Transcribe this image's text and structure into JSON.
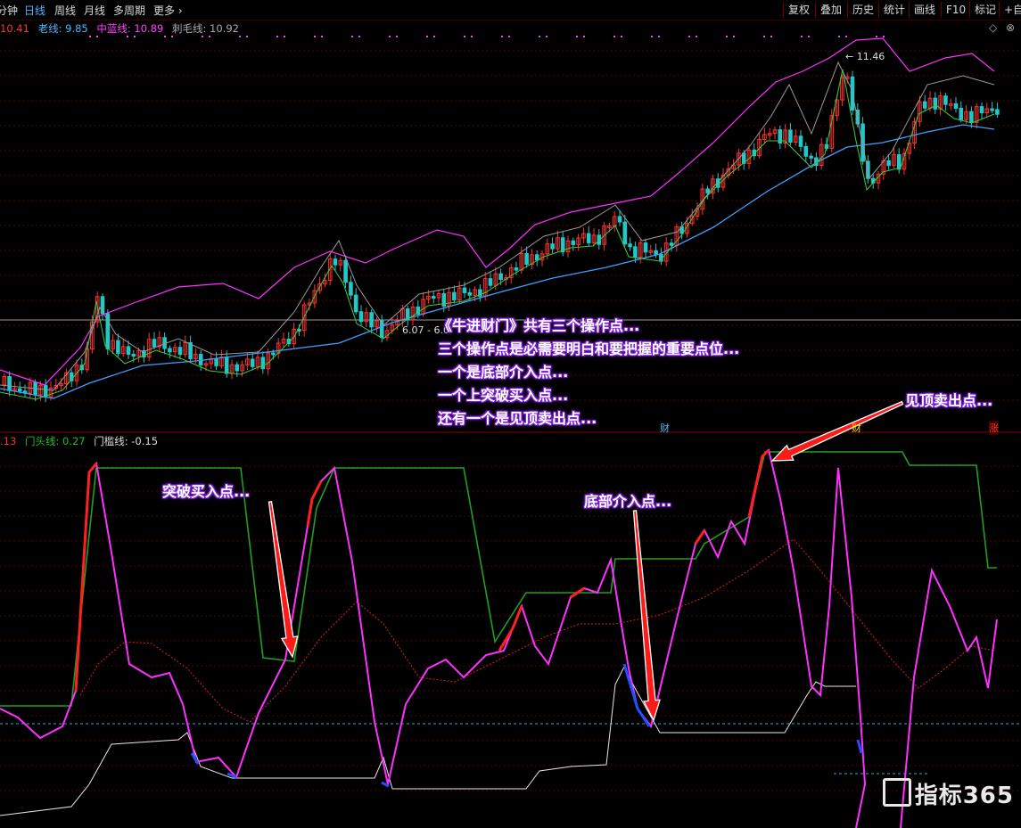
{
  "toolbar": {
    "left_tabs": [
      "分钟",
      "日线",
      "周线",
      "月线",
      "多周期",
      "更多"
    ],
    "active_tab": "日线",
    "right_buttons": [
      "复权",
      "叠加",
      "历史",
      "统计",
      "画线",
      "F10",
      "标记",
      "+自"
    ]
  },
  "top_legend": {
    "first_value": "10.41",
    "items": [
      {
        "label": "老线: 9.85",
        "color": "#52b5ff"
      },
      {
        "label": "中蓝线: 10.89",
        "color": "#ff40ff"
      },
      {
        "label": "刺毛线: 10.92",
        "color": "#aaaaaa"
      }
    ]
  },
  "price_chart": {
    "high_label": "11.46",
    "low_label": "6.07 - 6.0",
    "event_marks": [
      "财",
      "财",
      "涨"
    ]
  },
  "indicator_legend": {
    "first_value": ".13",
    "items": [
      {
        "label": "门头线: 0.27",
        "color": "#22c022"
      },
      {
        "label": "门槛线: -0.15",
        "color": "#dddddd"
      }
    ]
  },
  "annotations": {
    "main_text": [
      "《牛进财门》共有三个操作点...",
      "三个操作点是必需要明白和要把握的重要点位...",
      "一个是底部介入点...",
      "一个上突破买入点...",
      "还有一个是见顶卖出点..."
    ],
    "breakout_buy": "突破买入点...",
    "bottom_entry": "底部介入点...",
    "top_sell": "见顶卖出点..."
  },
  "logo": {
    "text": "指标365"
  },
  "colors": {
    "background": "#000000",
    "up_candle": "#ff3030",
    "down_candle": "#20c8c8",
    "blue_line": "#3fa0ff",
    "magenta_line": "#ff30ff",
    "green_line": "#1fa01f",
    "grid": "#5a0000"
  }
}
